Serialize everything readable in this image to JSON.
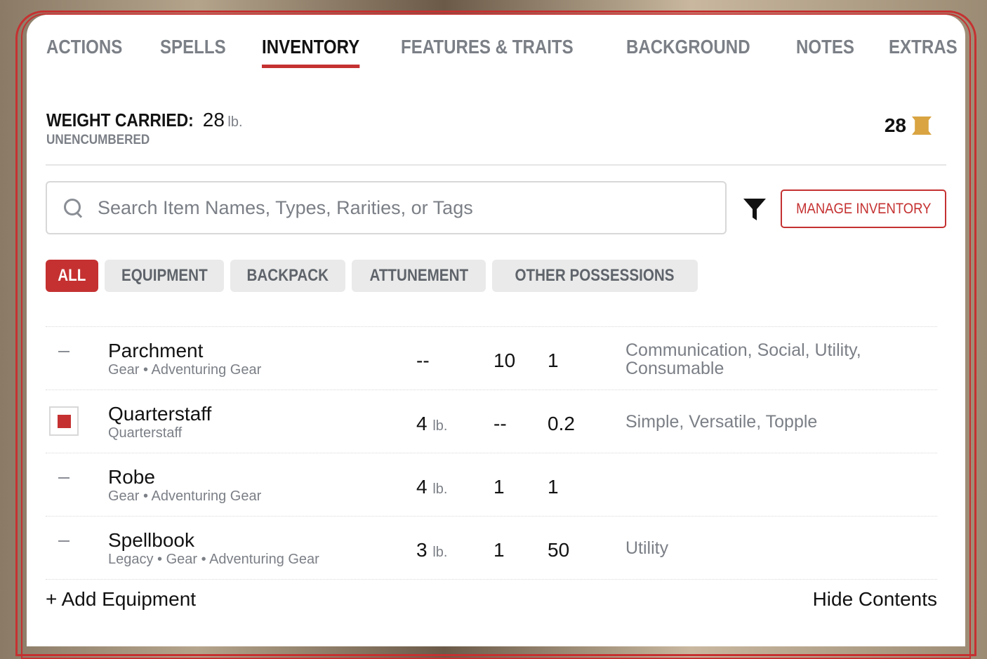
{
  "tabs": [
    "ACTIONS",
    "SPELLS",
    "INVENTORY",
    "FEATURES & TRAITS",
    "BACKGROUND",
    "NOTES",
    "EXTRAS"
  ],
  "active_tab": "INVENTORY",
  "weight": {
    "label": "WEIGHT CARRIED:",
    "value": "28",
    "unit": "lb.",
    "status": "UNENCUMBERED"
  },
  "currency": {
    "value": "28",
    "icon": "coin-icon",
    "color": "#d9a441"
  },
  "search": {
    "placeholder": "Search Item Names, Types, Rarities, or Tags",
    "value": ""
  },
  "manage_label": "MANAGE INVENTORY",
  "chips": [
    "ALL",
    "EQUIPMENT",
    "BACKPACK",
    "ATTUNEMENT",
    "OTHER POSSESSIONS"
  ],
  "active_chip": "ALL",
  "items": [
    {
      "name": "Parchment",
      "sub": "Gear • Adventuring Gear",
      "weight": "--",
      "unit": "",
      "qty": "10",
      "cost": "1",
      "notes": "Communication, Social, Utility, Consumable",
      "equipped": false
    },
    {
      "name": "Quarterstaff",
      "sub": "Quarterstaff",
      "weight": "4",
      "unit": "lb.",
      "qty": "--",
      "cost": "0.2",
      "notes": "Simple, Versatile, Topple",
      "equipped": true
    },
    {
      "name": "Robe",
      "sub": "Gear • Adventuring Gear",
      "weight": "4",
      "unit": "lb.",
      "qty": "1",
      "cost": "1",
      "notes": "",
      "equipped": false
    },
    {
      "name": "Spellbook",
      "sub": "Legacy • Gear • Adventuring Gear",
      "weight": "3",
      "unit": "lb.",
      "qty": "1",
      "cost": "50",
      "notes": "Utility",
      "equipped": false
    }
  ],
  "footer": {
    "add_label": "+ Add Equipment",
    "hide_label": "Hide Contents"
  },
  "accent_color": "#c53131"
}
